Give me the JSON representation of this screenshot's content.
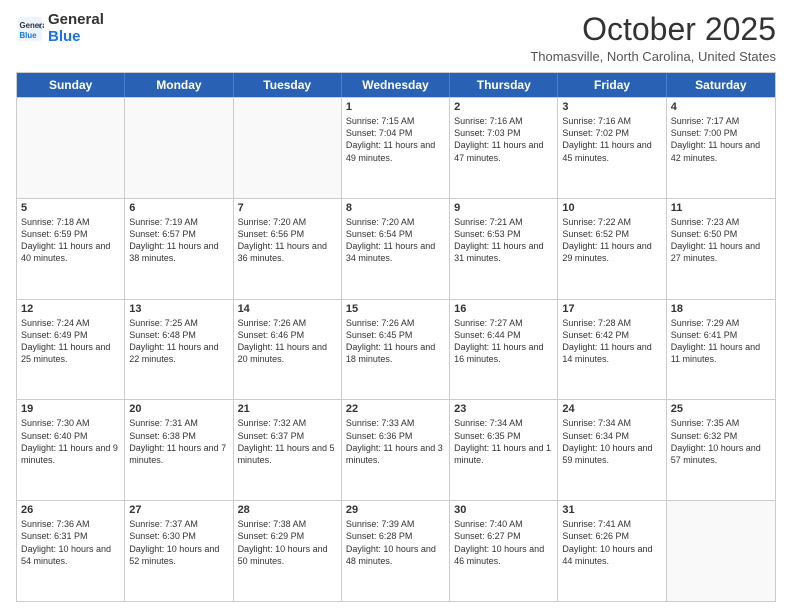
{
  "logo": {
    "general": "General",
    "blue": "Blue"
  },
  "header": {
    "month": "October 2025",
    "location": "Thomasville, North Carolina, United States"
  },
  "days_of_week": [
    "Sunday",
    "Monday",
    "Tuesday",
    "Wednesday",
    "Thursday",
    "Friday",
    "Saturday"
  ],
  "rows": [
    [
      {
        "day": "",
        "empty": true
      },
      {
        "day": "",
        "empty": true
      },
      {
        "day": "",
        "empty": true
      },
      {
        "day": "1",
        "rise": "7:15 AM",
        "set": "7:04 PM",
        "daylight": "11 hours and 49 minutes."
      },
      {
        "day": "2",
        "rise": "7:16 AM",
        "set": "7:03 PM",
        "daylight": "11 hours and 47 minutes."
      },
      {
        "day": "3",
        "rise": "7:16 AM",
        "set": "7:02 PM",
        "daylight": "11 hours and 45 minutes."
      },
      {
        "day": "4",
        "rise": "7:17 AM",
        "set": "7:00 PM",
        "daylight": "11 hours and 42 minutes."
      }
    ],
    [
      {
        "day": "5",
        "rise": "7:18 AM",
        "set": "6:59 PM",
        "daylight": "11 hours and 40 minutes."
      },
      {
        "day": "6",
        "rise": "7:19 AM",
        "set": "6:57 PM",
        "daylight": "11 hours and 38 minutes."
      },
      {
        "day": "7",
        "rise": "7:20 AM",
        "set": "6:56 PM",
        "daylight": "11 hours and 36 minutes."
      },
      {
        "day": "8",
        "rise": "7:20 AM",
        "set": "6:54 PM",
        "daylight": "11 hours and 34 minutes."
      },
      {
        "day": "9",
        "rise": "7:21 AM",
        "set": "6:53 PM",
        "daylight": "11 hours and 31 minutes."
      },
      {
        "day": "10",
        "rise": "7:22 AM",
        "set": "6:52 PM",
        "daylight": "11 hours and 29 minutes."
      },
      {
        "day": "11",
        "rise": "7:23 AM",
        "set": "6:50 PM",
        "daylight": "11 hours and 27 minutes."
      }
    ],
    [
      {
        "day": "12",
        "rise": "7:24 AM",
        "set": "6:49 PM",
        "daylight": "11 hours and 25 minutes."
      },
      {
        "day": "13",
        "rise": "7:25 AM",
        "set": "6:48 PM",
        "daylight": "11 hours and 22 minutes."
      },
      {
        "day": "14",
        "rise": "7:26 AM",
        "set": "6:46 PM",
        "daylight": "11 hours and 20 minutes."
      },
      {
        "day": "15",
        "rise": "7:26 AM",
        "set": "6:45 PM",
        "daylight": "11 hours and 18 minutes."
      },
      {
        "day": "16",
        "rise": "7:27 AM",
        "set": "6:44 PM",
        "daylight": "11 hours and 16 minutes."
      },
      {
        "day": "17",
        "rise": "7:28 AM",
        "set": "6:42 PM",
        "daylight": "11 hours and 14 minutes."
      },
      {
        "day": "18",
        "rise": "7:29 AM",
        "set": "6:41 PM",
        "daylight": "11 hours and 11 minutes."
      }
    ],
    [
      {
        "day": "19",
        "rise": "7:30 AM",
        "set": "6:40 PM",
        "daylight": "11 hours and 9 minutes."
      },
      {
        "day": "20",
        "rise": "7:31 AM",
        "set": "6:38 PM",
        "daylight": "11 hours and 7 minutes."
      },
      {
        "day": "21",
        "rise": "7:32 AM",
        "set": "6:37 PM",
        "daylight": "11 hours and 5 minutes."
      },
      {
        "day": "22",
        "rise": "7:33 AM",
        "set": "6:36 PM",
        "daylight": "11 hours and 3 minutes."
      },
      {
        "day": "23",
        "rise": "7:34 AM",
        "set": "6:35 PM",
        "daylight": "11 hours and 1 minute."
      },
      {
        "day": "24",
        "rise": "7:34 AM",
        "set": "6:34 PM",
        "daylight": "10 hours and 59 minutes."
      },
      {
        "day": "25",
        "rise": "7:35 AM",
        "set": "6:32 PM",
        "daylight": "10 hours and 57 minutes."
      }
    ],
    [
      {
        "day": "26",
        "rise": "7:36 AM",
        "set": "6:31 PM",
        "daylight": "10 hours and 54 minutes."
      },
      {
        "day": "27",
        "rise": "7:37 AM",
        "set": "6:30 PM",
        "daylight": "10 hours and 52 minutes."
      },
      {
        "day": "28",
        "rise": "7:38 AM",
        "set": "6:29 PM",
        "daylight": "10 hours and 50 minutes."
      },
      {
        "day": "29",
        "rise": "7:39 AM",
        "set": "6:28 PM",
        "daylight": "10 hours and 48 minutes."
      },
      {
        "day": "30",
        "rise": "7:40 AM",
        "set": "6:27 PM",
        "daylight": "10 hours and 46 minutes."
      },
      {
        "day": "31",
        "rise": "7:41 AM",
        "set": "6:26 PM",
        "daylight": "10 hours and 44 minutes."
      },
      {
        "day": "",
        "empty": true
      }
    ]
  ]
}
